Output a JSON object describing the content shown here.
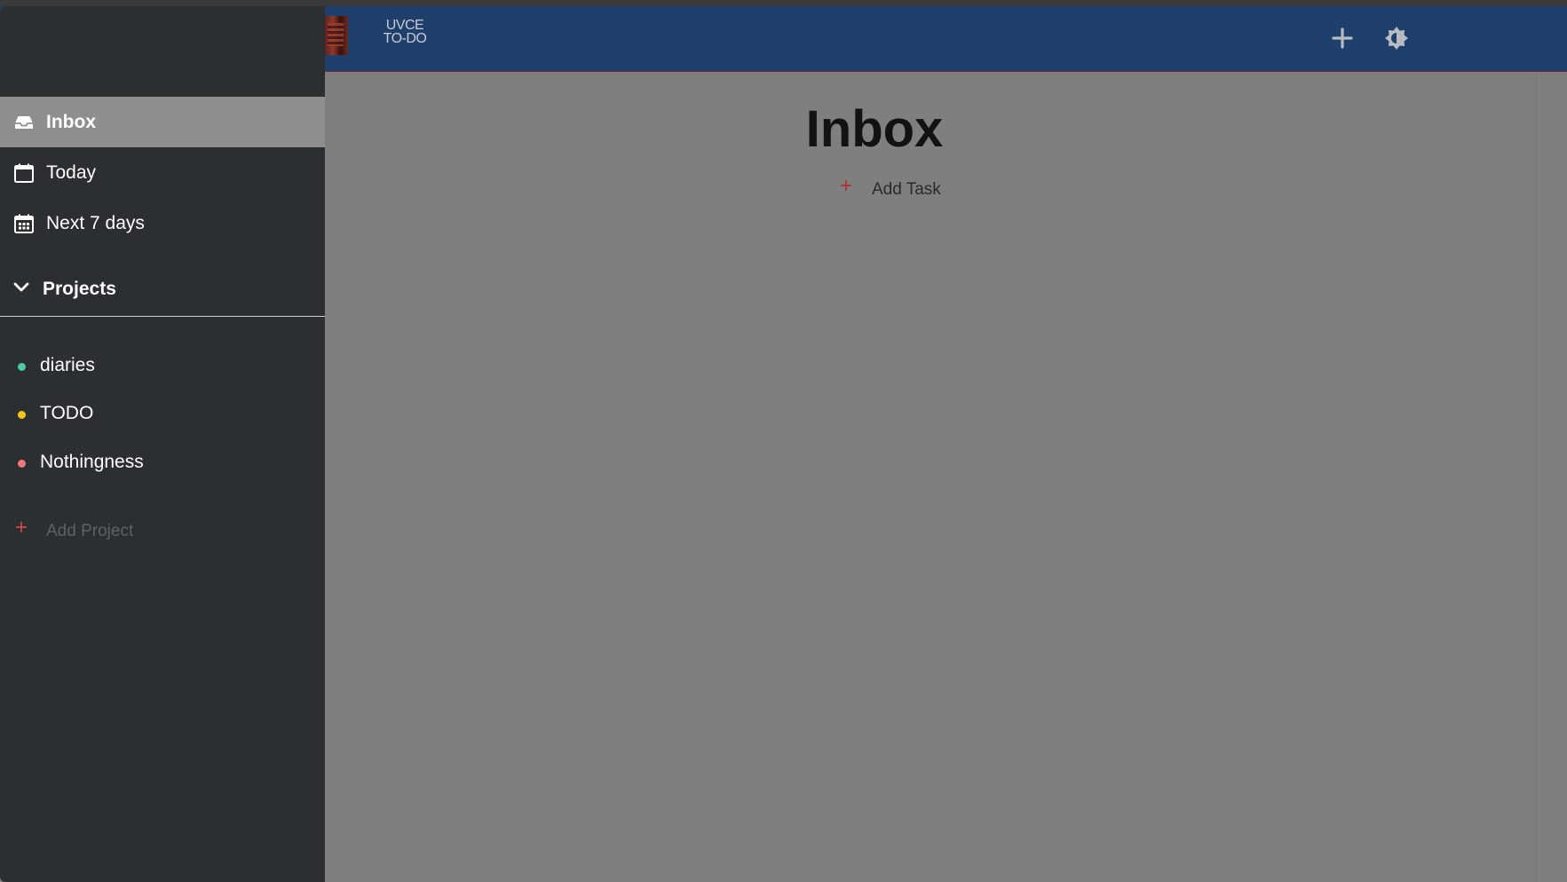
{
  "header": {
    "logo_line1": "UVCE",
    "logo_line2": "TO-DO",
    "add_icon": "plus-icon",
    "theme_icon": "brightness-icon"
  },
  "sidebar": {
    "items": [
      {
        "label": "Inbox",
        "icon": "inbox-icon",
        "active": true
      },
      {
        "label": "Today",
        "icon": "calendar-icon",
        "active": false
      },
      {
        "label": "Next 7 days",
        "icon": "calendar-week-icon",
        "active": false
      }
    ],
    "projects_label": "Projects",
    "projects": [
      {
        "name": "diaries",
        "color": "#4fc9a6"
      },
      {
        "name": "TODO",
        "color": "#f5c518"
      },
      {
        "name": "Nothingness",
        "color": "#f07878"
      }
    ],
    "add_project_label": "Add Project"
  },
  "main": {
    "title": "Inbox",
    "add_task_label": "Add Task"
  },
  "colors": {
    "header_bg": "#1f406c",
    "sidebar_bg": "#2b2f31",
    "content_bg": "#7f7f7f",
    "accent_red": "#d24343"
  }
}
